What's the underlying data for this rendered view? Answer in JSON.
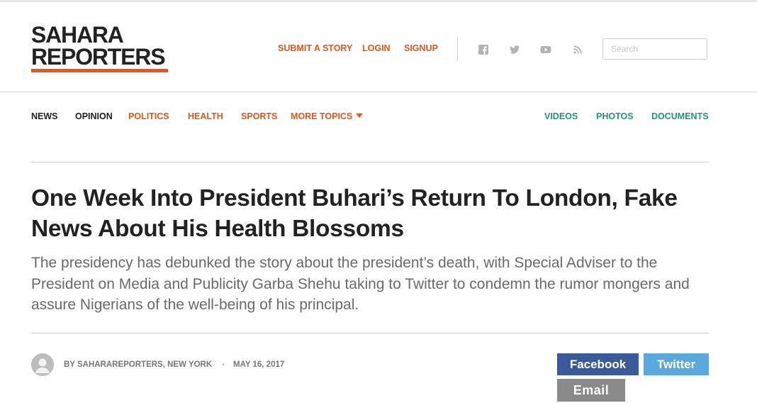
{
  "brand": {
    "line1": "SAHARA",
    "line2": "REPORTERS",
    "accent_color": "#ec5512"
  },
  "utility_nav": {
    "submit": "SUBMIT A STORY",
    "login": "LOGIN",
    "signup": "SIGNUP"
  },
  "social": [
    "facebook-icon",
    "twitter-icon",
    "youtube-icon",
    "rss-icon"
  ],
  "search": {
    "placeholder": "Search",
    "value": ""
  },
  "main_nav": {
    "news": "NEWS",
    "opinion": "OPINION",
    "politics": "POLITICS",
    "health": "HEALTH",
    "sports": "SPORTS",
    "more_topics": "MORE TOPICS",
    "videos": "VIDEOS",
    "photos": "PHOTOS",
    "documents": "DOCUMENTS",
    "teal_color": "#1e9878"
  },
  "article": {
    "headline": "One Week Into President Buhari’s Return To London, Fake News About His Health Blossoms",
    "dek": "The presidency has debunked the story about the president’s death, with Special Adviser to the President on Media and Publicity Garba Shehu taking to Twitter to condemn the rumor mongers and assure Nigerians of the well-being of his principal.",
    "byline": "BY SAHARAREPORTERS, NEW YORK",
    "separator": "•",
    "date": "MAY 16, 2017"
  },
  "share": {
    "facebook": "Facebook",
    "twitter": "Twitter",
    "email": "Email",
    "facebook_color": "#3b5a99",
    "twitter_color": "#5aa9de",
    "email_color": "#8a8a8a"
  }
}
